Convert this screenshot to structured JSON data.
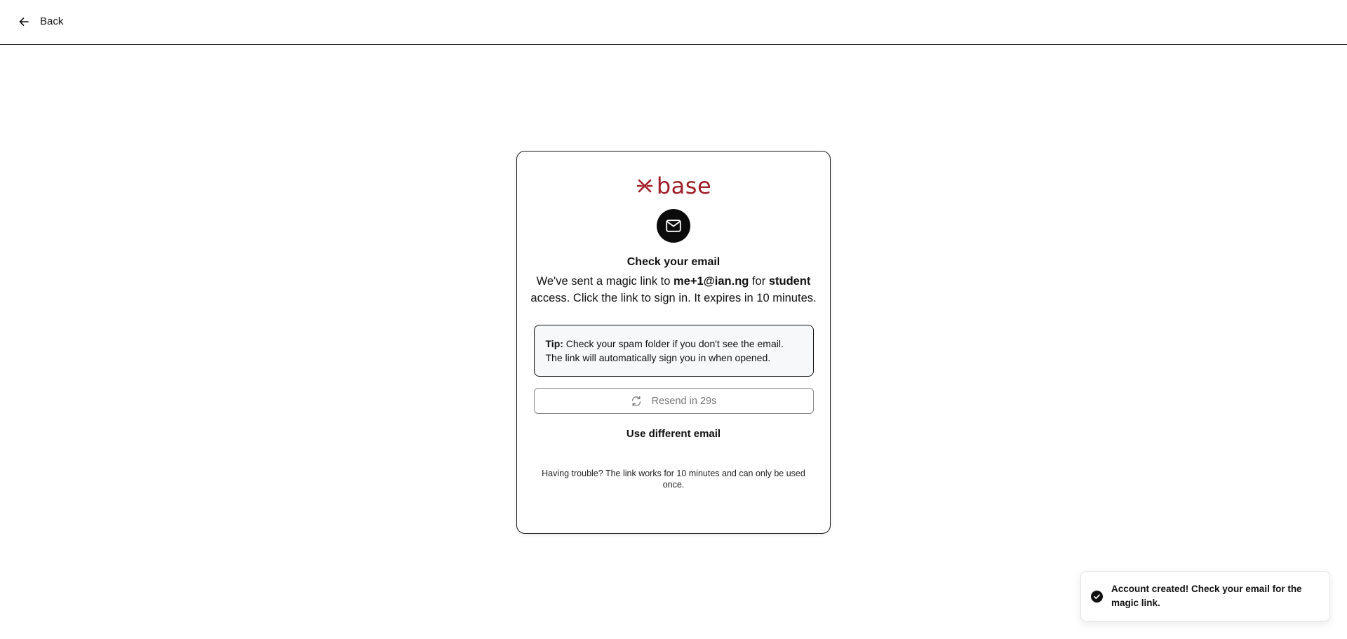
{
  "header": {
    "back_label": "Back"
  },
  "card": {
    "logo_text": "base",
    "title": "Check your email",
    "desc_prefix": "We've sent a magic link to ",
    "email": "me+1@ian.ng",
    "desc_mid": " for ",
    "role": "student",
    "desc_suffix": " access. Click the link to sign in. It expires in 10 minutes.",
    "tip_label": "Tip:",
    "tip_text": " Check your spam folder if you don't see the email. The link will automatically sign you in when opened.",
    "resend_label": "Resend in 29s",
    "different_email_label": "Use different email",
    "trouble_text": "Having trouble? The link works for 10 minutes and can only be used once."
  },
  "toast": {
    "message": "Account created! Check your email for the magic link."
  },
  "colors": {
    "brand": "#a01e28",
    "border": "#1a1a1a",
    "tip_bg": "#f7f8f9",
    "muted": "#777777"
  },
  "icons": {
    "back": "arrow-left-icon",
    "logo": "base-logo-icon",
    "mail": "mail-icon",
    "resend": "refresh-icon",
    "toast": "check-circle-icon"
  }
}
